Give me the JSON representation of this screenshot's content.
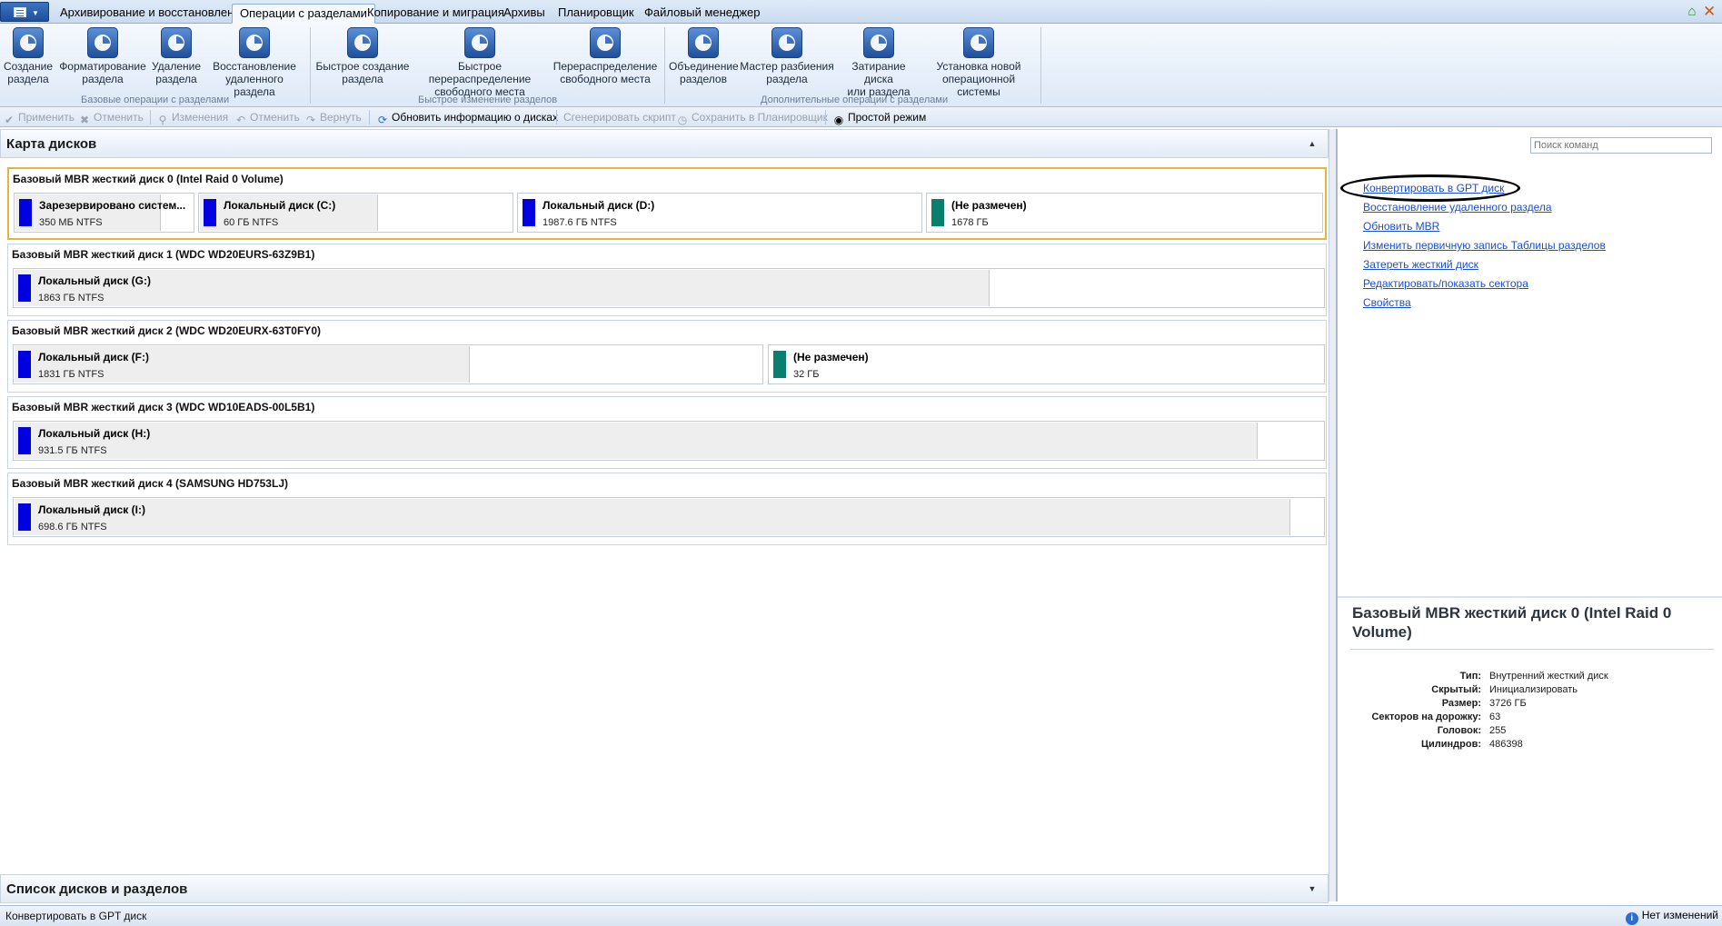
{
  "tabs": [
    {
      "label": "Архивирование и восстановление",
      "active": false
    },
    {
      "label": "Операции с разделами",
      "active": true
    },
    {
      "label": "Копирование и миграция",
      "active": false
    },
    {
      "label": "Архивы",
      "active": false
    },
    {
      "label": "Планировщик",
      "active": false
    },
    {
      "label": "Файловый менеджер",
      "active": false
    }
  ],
  "ribbon": {
    "buttons": [
      {
        "line1": "Создание",
        "line2": "раздела",
        "icon": "create-partition-icon"
      },
      {
        "line1": "Форматирование",
        "line2": "раздела",
        "icon": "format-partition-icon"
      },
      {
        "line1": "Удаление",
        "line2": "раздела",
        "icon": "delete-partition-icon"
      },
      {
        "line1": "Восстановление",
        "line2": "удаленного раздела",
        "icon": "recover-partition-icon"
      },
      {
        "line1": "Быстрое создание",
        "line2": "раздела",
        "icon": "quick-create-icon"
      },
      {
        "line1": "Быстрое перераспределение",
        "line2": "свободного места",
        "icon": "quick-redistribute-icon"
      },
      {
        "line1": "Перераспределение",
        "line2": "свободного места",
        "icon": "redistribute-icon"
      },
      {
        "line1": "Объединение",
        "line2": "разделов",
        "icon": "merge-partitions-icon"
      },
      {
        "line1": "Мастер разбиения",
        "line2": "раздела",
        "icon": "split-wizard-icon"
      },
      {
        "line1": "Затирание диска",
        "line2": "или раздела",
        "icon": "wipe-disk-icon"
      },
      {
        "line1": "Установка новой",
        "line2": "операционной системы",
        "icon": "install-os-icon"
      }
    ],
    "groups": [
      "Базовые операции с разделами",
      "Быстрое изменение разделов",
      "Дополнительные операции с разделами"
    ]
  },
  "toolbar": {
    "apply": "Применить",
    "cancel": "Отменить",
    "changes": "Изменения",
    "undo": "Отменить",
    "redo": "Вернуть",
    "refresh": "Обновить информацию о дисках",
    "script": "Сгенерировать скрипт",
    "save_sched": "Сохранить в Планировщик",
    "simple_mode": "Простой режим"
  },
  "diskmap": {
    "title": "Карта дисков",
    "list_title": "Список дисков и разделов",
    "disks": [
      {
        "name": "Базовый MBR жесткий диск 0 (Intel Raid 0 Volume)",
        "selected": true,
        "partitions": [
          {
            "name": "Зарезервировано систем...",
            "info": "350 МБ NTFS",
            "color": "#0000e0",
            "used": 0.82
          },
          {
            "name": "Локальный диск (C:)",
            "info": "60 ГБ NTFS",
            "color": "#0000e0",
            "used": 0.57
          },
          {
            "name": "Локальный диск (D:)",
            "info": "1987.6 ГБ NTFS",
            "color": "#0000e0",
            "used": 0.0
          },
          {
            "name": "(Не размечен)",
            "info": "1678 ГБ",
            "color": "#0a7f6e",
            "used": 0.0
          }
        ]
      },
      {
        "name": "Базовый MBR жесткий диск 1 (WDC WD20EURS-63Z9B1)",
        "selected": false,
        "partitions": [
          {
            "name": "Локальный диск (G:)",
            "info": "1863 ГБ NTFS",
            "color": "#0000e0",
            "used": 0.745
          }
        ]
      },
      {
        "name": "Базовый MBR жесткий диск 2 (WDC WD20EURX-63T0FY0)",
        "selected": false,
        "partitions": [
          {
            "name": "Локальный диск (F:)",
            "info": "1831 ГБ NTFS",
            "color": "#0000e0",
            "used": 0.61
          },
          {
            "name": "(Не размечен)",
            "info": "32 ГБ",
            "color": "#0a7f6e",
            "used": 0.0
          }
        ]
      },
      {
        "name": "Базовый MBR жесткий диск 3 (WDC WD10EADS-00L5B1)",
        "selected": false,
        "partitions": [
          {
            "name": "Локальный диск (H:)",
            "info": "931.5 ГБ NTFS",
            "color": "#0000e0",
            "used": 0.95
          }
        ]
      },
      {
        "name": "Базовый MBR жесткий диск 4 (SAMSUNG HD753LJ)",
        "selected": false,
        "partitions": [
          {
            "name": "Локальный диск (I:)",
            "info": "698.6 ГБ NTFS",
            "color": "#0000e0",
            "used": 0.975
          }
        ]
      }
    ]
  },
  "right": {
    "search_placeholder": "Поиск команд",
    "commands": [
      "Конвертировать в GPT диск",
      "Восстановление удаленного раздела",
      "Обновить MBR",
      "Изменить первичную запись Таблицы разделов",
      "Затереть жесткий диск",
      "Редактировать/показать сектора",
      "Свойства"
    ],
    "props_title": "Базовый MBR жесткий диск 0 (Intel Raid 0 Volume)",
    "props": [
      {
        "k": "Тип:",
        "v": "Внутренний жесткий диск"
      },
      {
        "k": "Скрытый:",
        "v": "Инициализировать"
      },
      {
        "k": "Размер:",
        "v": "3726 ГБ"
      },
      {
        "k": "Секторов на дорожку:",
        "v": "63"
      },
      {
        "k": "Головок:",
        "v": "255"
      },
      {
        "k": "Цилиндров:",
        "v": "486398"
      }
    ]
  },
  "status": {
    "text": "Конвертировать в GPT диск",
    "right": "Нет изменений"
  }
}
